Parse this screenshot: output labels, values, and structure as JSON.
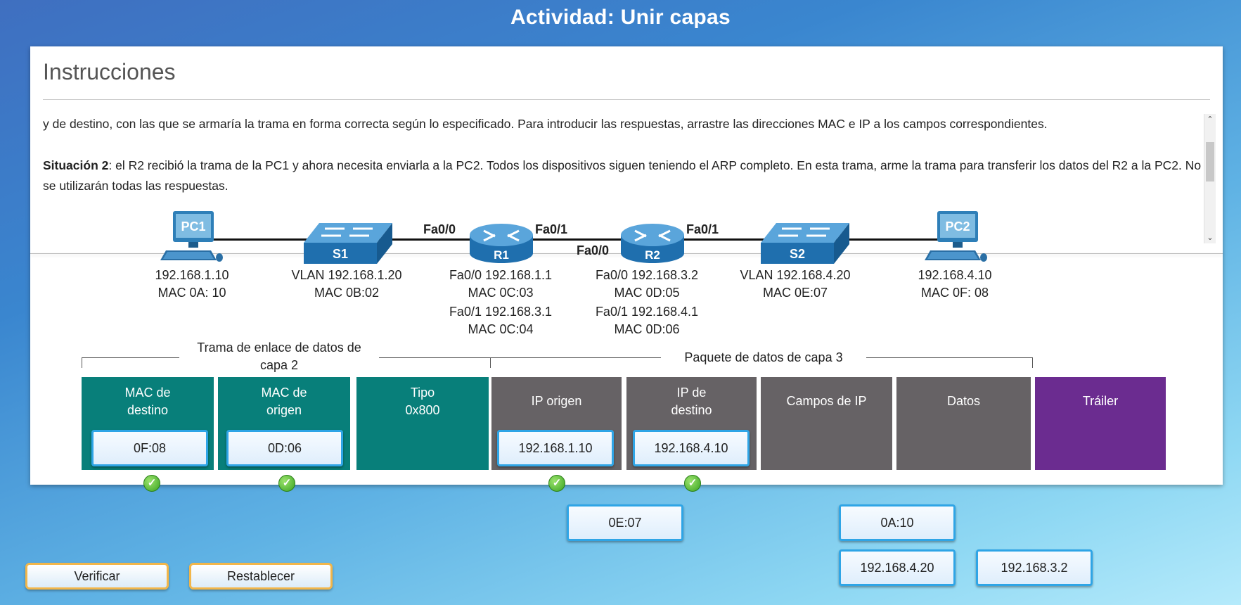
{
  "title": "Actividad: Unir capas",
  "instructions": {
    "heading": "Instrucciones",
    "paragraph1": "y de destino, con las que se armaría la trama en forma correcta según lo especificado. Para introducir las respuestas, arrastre las direcciones MAC e IP a los campos correspondientes.",
    "situation_label": "Situación 2",
    "situation_text": ": el R2 recibió la trama de la PC1 y ahora necesita enviarla a la PC2. Todos los dispositivos siguen teniendo el ARP completo. En esta trama, arme la trama para transferir los datos del R2 a la PC2. No se utilizarán todas las respuestas."
  },
  "topology": {
    "pc1": {
      "name": "PC1",
      "ip": "192.168.1.10",
      "mac": "MAC 0A: 10"
    },
    "s1": {
      "name": "S1",
      "vlan": "VLAN 192.168.1.20",
      "mac": "MAC 0B:02"
    },
    "r1": {
      "name": "R1",
      "f00": "Fa0/0 192.168.1.1",
      "mac00": "MAC 0C:03",
      "f01": "Fa0/1 192.168.3.1",
      "mac01": "MAC 0C:04"
    },
    "r2": {
      "name": "R2",
      "f00": "Fa0/0 192.168.3.2",
      "mac00": "MAC 0D:05",
      "f01": "Fa0/1 192.168.4.1",
      "mac01": "MAC 0D:06"
    },
    "s2": {
      "name": "S2",
      "vlan": "VLAN 192.168.4.20",
      "mac": "MAC 0E:07"
    },
    "pc2": {
      "name": "PC2",
      "ip": "192.168.4.10",
      "mac": "MAC 0F: 08"
    },
    "ports": {
      "r1_left": "Fa0/0",
      "r1_right": "Fa0/1",
      "r2_left": "Fa0/0",
      "r2_right": "Fa0/1"
    }
  },
  "frame": {
    "layer2_label": "Trama de enlace de datos de capa 2",
    "layer3_label": "Paquete de datos de capa 3",
    "fields": {
      "mac_dest": "MAC de destino",
      "mac_src": "MAC de origen",
      "type": "Tipo 0x800",
      "ip_src": "IP origen",
      "ip_dest": "IP de destino",
      "ip_fields": "Campos de IP",
      "data": "Datos",
      "trailer": "Tráiler"
    },
    "placed": {
      "mac_dest": "0F:08",
      "mac_src": "0D:06",
      "ip_src": "192.168.1.10",
      "ip_dest": "192.168.4.10"
    }
  },
  "answers": {
    "a1": "0E:07",
    "a2": "0A:10",
    "a3": "192.168.4.20",
    "a4": "192.168.3.2"
  },
  "buttons": {
    "verify": "Verificar",
    "reset": "Restablecer"
  },
  "colors": {
    "layer2": "#087f7a",
    "layer3": "#666265",
    "trailer": "#6b2c90",
    "answer_border": "#2fa5e6",
    "button_border": "#f2b64a"
  }
}
